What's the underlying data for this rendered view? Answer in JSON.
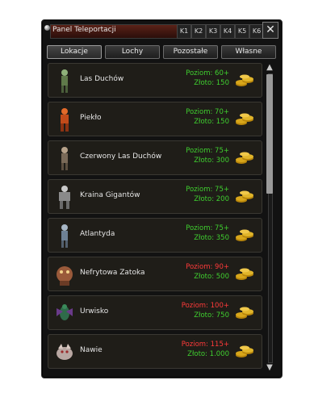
{
  "window": {
    "title": "Panel Teleportacji",
    "k_tabs": [
      "K1",
      "K2",
      "K3",
      "K4",
      "K5",
      "K6"
    ],
    "close_label": "✕"
  },
  "tabs": [
    {
      "label": "Lokacje",
      "active": true
    },
    {
      "label": "Lochy",
      "active": false
    },
    {
      "label": "Pozostałe",
      "active": false
    },
    {
      "label": "Własne",
      "active": false
    }
  ],
  "locations": [
    {
      "name": "Las Duchów",
      "level": "Poziom: 60+",
      "gold": "Złoto: 150",
      "level_color": "#3fcf2f",
      "icon": "forest-spirit-icon"
    },
    {
      "name": "Piekło",
      "level": "Poziom: 70+",
      "gold": "Złoto: 150",
      "level_color": "#3fcf2f",
      "icon": "demon-icon"
    },
    {
      "name": "Czerwony Las Duchów",
      "level": "Poziom: 75+",
      "gold": "Złoto: 300",
      "level_color": "#3fcf2f",
      "icon": "red-forest-spirit-icon"
    },
    {
      "name": "Kraina Gigantów",
      "level": "Poziom: 75+",
      "gold": "Złoto: 200",
      "level_color": "#3fcf2f",
      "icon": "giant-icon"
    },
    {
      "name": "Atlantyda",
      "level": "Poziom: 75+",
      "gold": "Złoto: 350",
      "level_color": "#3fcf2f",
      "icon": "atlantis-warrior-icon"
    },
    {
      "name": "Nefrytowa Zatoka",
      "level": "Poziom: 90+",
      "gold": "Złoto: 500",
      "level_color": "#ff3a3a",
      "icon": "jade-bay-monster-icon"
    },
    {
      "name": "Urwisko",
      "level": "Poziom: 100+",
      "gold": "Złoto: 750",
      "level_color": "#ff3a3a",
      "icon": "cliff-insect-icon"
    },
    {
      "name": "Nawie",
      "level": "Poziom: 115+",
      "gold": "Złoto: 1.000",
      "level_color": "#ff3a3a",
      "icon": "nawie-beast-icon"
    }
  ],
  "colors": {
    "level_ok": "#3fcf2f",
    "level_locked": "#ff3a3a",
    "gold_text": "#3fcf2f",
    "coin": "#d8a61a"
  },
  "icons": {
    "teleport_button": "gold-coins-icon",
    "scroll_up": "arrow-up-icon",
    "scroll_down": "arrow-down-icon"
  }
}
